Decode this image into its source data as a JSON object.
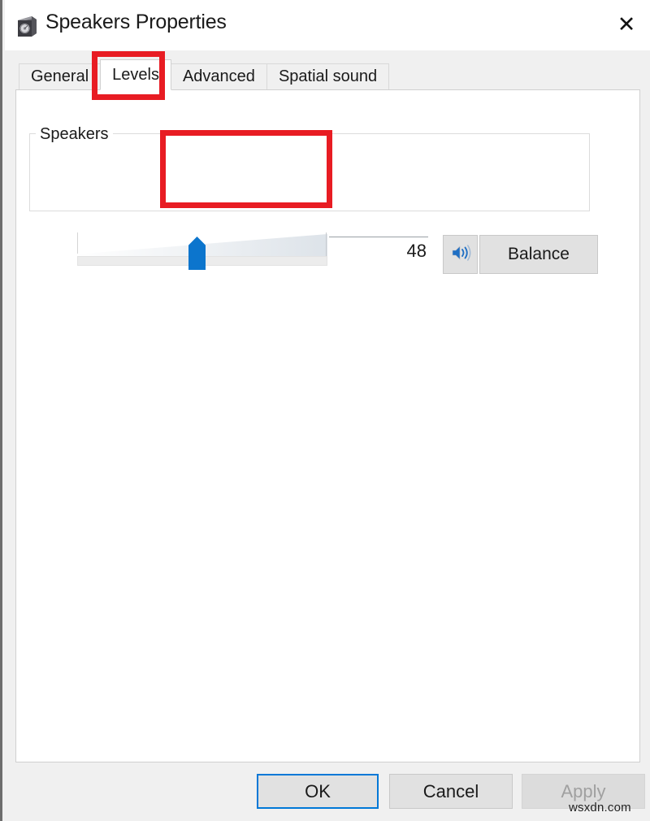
{
  "window": {
    "title": "Speakers Properties",
    "icon": "speaker-box-icon",
    "close_label": "✕"
  },
  "tabs": [
    {
      "label": "General",
      "active": false
    },
    {
      "label": "Levels",
      "active": true
    },
    {
      "label": "Advanced",
      "active": false
    },
    {
      "label": "Spatial sound",
      "active": false
    }
  ],
  "levels": {
    "group_label": "Speakers",
    "volume_value": "48",
    "volume_min": 0,
    "volume_max": 100,
    "mute_icon": "speaker-volume-icon",
    "balance_label": "Balance"
  },
  "footer": {
    "ok_label": "OK",
    "cancel_label": "Cancel",
    "apply_label": "Apply"
  },
  "watermark": {
    "text": "wsxdn.com"
  },
  "annotations": {
    "accent_color": "#e81c23",
    "highlight_tab": "Levels",
    "highlight_control": "volume-slider"
  },
  "colors": {
    "accent": "#0078d7",
    "slider_thumb": "#0c75cd",
    "window_chrome": "#f0f0f0",
    "panel": "#ffffff",
    "annotation_red": "#e81c23"
  }
}
